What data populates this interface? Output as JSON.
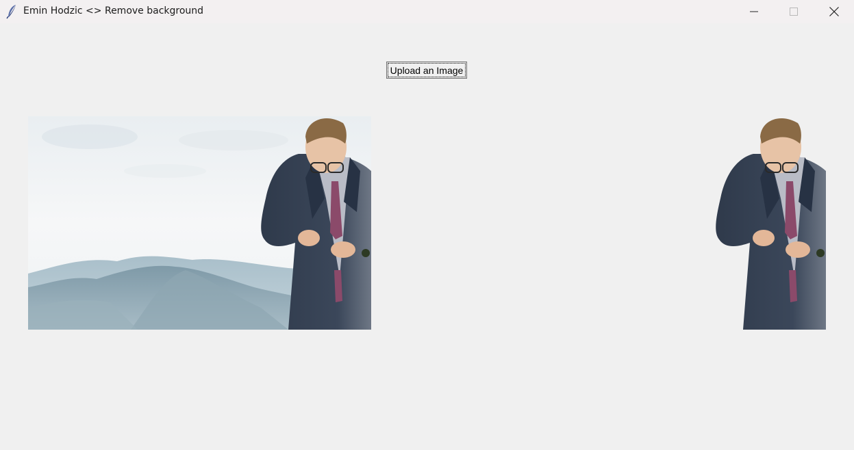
{
  "window": {
    "title": "Emin Hodzic <> Remove background",
    "icon": "feather-icon",
    "controls": {
      "minimize": "minimize-icon",
      "maximize": "maximize-icon",
      "close": "close-icon"
    }
  },
  "main": {
    "upload_button_label": "Upload an Image"
  },
  "images": {
    "original": "original-photo",
    "result": "background-removed-photo"
  }
}
